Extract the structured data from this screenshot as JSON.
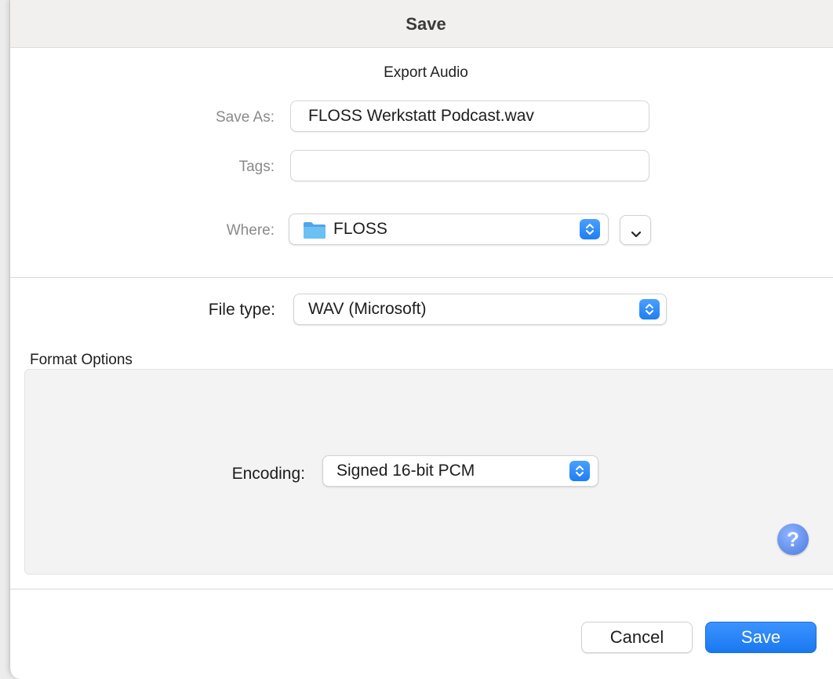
{
  "window": {
    "title": "Save"
  },
  "dialog": {
    "subtitle": "Export Audio"
  },
  "save_as": {
    "label": "Save As:",
    "value": "FLOSS Werkstatt Podcast.wav"
  },
  "tags": {
    "label": "Tags:",
    "value": ""
  },
  "where": {
    "label": "Where:",
    "value": "FLOSS",
    "icon": "folder-icon"
  },
  "file_type": {
    "label": "File type:",
    "value": "WAV (Microsoft)"
  },
  "format_options": {
    "heading": "Format Options",
    "encoding": {
      "label": "Encoding:",
      "value": "Signed 16-bit PCM"
    },
    "help_glyph": "?"
  },
  "buttons": {
    "cancel": "Cancel",
    "save": "Save"
  },
  "colors": {
    "accent": "#1f7ef2",
    "folder": "#5fb4ef"
  }
}
